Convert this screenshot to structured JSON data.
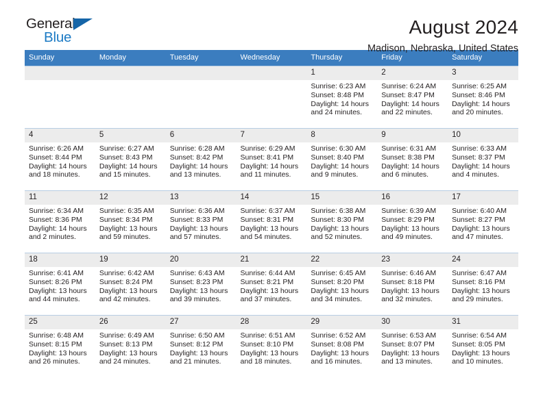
{
  "brand": {
    "name_part1": "General",
    "name_part2": "Blue",
    "accent_color": "#1b7ac4",
    "triangle_color": "#1565a8"
  },
  "header": {
    "title": "August 2024",
    "subtitle": "Madison, Nebraska, United States"
  },
  "calendar": {
    "header_bg": "#3b7dbf",
    "daynum_bg": "#ececec",
    "grid_line_color": "#b7cde3",
    "weekdays": [
      "Sunday",
      "Monday",
      "Tuesday",
      "Wednesday",
      "Thursday",
      "Friday",
      "Saturday"
    ],
    "labels": {
      "sunrise": "Sunrise:",
      "sunset": "Sunset:",
      "daylight": "Daylight:"
    },
    "weeks": [
      [
        {
          "day": "",
          "empty": true
        },
        {
          "day": "",
          "empty": true
        },
        {
          "day": "",
          "empty": true
        },
        {
          "day": "",
          "empty": true
        },
        {
          "day": "1",
          "sunrise": "Sunrise: 6:23 AM",
          "sunset": "Sunset: 8:48 PM",
          "daylight_line1": "Daylight: 14 hours",
          "daylight_line2": "and 24 minutes."
        },
        {
          "day": "2",
          "sunrise": "Sunrise: 6:24 AM",
          "sunset": "Sunset: 8:47 PM",
          "daylight_line1": "Daylight: 14 hours",
          "daylight_line2": "and 22 minutes."
        },
        {
          "day": "3",
          "sunrise": "Sunrise: 6:25 AM",
          "sunset": "Sunset: 8:46 PM",
          "daylight_line1": "Daylight: 14 hours",
          "daylight_line2": "and 20 minutes."
        }
      ],
      [
        {
          "day": "4",
          "sunrise": "Sunrise: 6:26 AM",
          "sunset": "Sunset: 8:44 PM",
          "daylight_line1": "Daylight: 14 hours",
          "daylight_line2": "and 18 minutes."
        },
        {
          "day": "5",
          "sunrise": "Sunrise: 6:27 AM",
          "sunset": "Sunset: 8:43 PM",
          "daylight_line1": "Daylight: 14 hours",
          "daylight_line2": "and 15 minutes."
        },
        {
          "day": "6",
          "sunrise": "Sunrise: 6:28 AM",
          "sunset": "Sunset: 8:42 PM",
          "daylight_line1": "Daylight: 14 hours",
          "daylight_line2": "and 13 minutes."
        },
        {
          "day": "7",
          "sunrise": "Sunrise: 6:29 AM",
          "sunset": "Sunset: 8:41 PM",
          "daylight_line1": "Daylight: 14 hours",
          "daylight_line2": "and 11 minutes."
        },
        {
          "day": "8",
          "sunrise": "Sunrise: 6:30 AM",
          "sunset": "Sunset: 8:40 PM",
          "daylight_line1": "Daylight: 14 hours",
          "daylight_line2": "and 9 minutes."
        },
        {
          "day": "9",
          "sunrise": "Sunrise: 6:31 AM",
          "sunset": "Sunset: 8:38 PM",
          "daylight_line1": "Daylight: 14 hours",
          "daylight_line2": "and 6 minutes."
        },
        {
          "day": "10",
          "sunrise": "Sunrise: 6:33 AM",
          "sunset": "Sunset: 8:37 PM",
          "daylight_line1": "Daylight: 14 hours",
          "daylight_line2": "and 4 minutes."
        }
      ],
      [
        {
          "day": "11",
          "sunrise": "Sunrise: 6:34 AM",
          "sunset": "Sunset: 8:36 PM",
          "daylight_line1": "Daylight: 14 hours",
          "daylight_line2": "and 2 minutes."
        },
        {
          "day": "12",
          "sunrise": "Sunrise: 6:35 AM",
          "sunset": "Sunset: 8:34 PM",
          "daylight_line1": "Daylight: 13 hours",
          "daylight_line2": "and 59 minutes."
        },
        {
          "day": "13",
          "sunrise": "Sunrise: 6:36 AM",
          "sunset": "Sunset: 8:33 PM",
          "daylight_line1": "Daylight: 13 hours",
          "daylight_line2": "and 57 minutes."
        },
        {
          "day": "14",
          "sunrise": "Sunrise: 6:37 AM",
          "sunset": "Sunset: 8:31 PM",
          "daylight_line1": "Daylight: 13 hours",
          "daylight_line2": "and 54 minutes."
        },
        {
          "day": "15",
          "sunrise": "Sunrise: 6:38 AM",
          "sunset": "Sunset: 8:30 PM",
          "daylight_line1": "Daylight: 13 hours",
          "daylight_line2": "and 52 minutes."
        },
        {
          "day": "16",
          "sunrise": "Sunrise: 6:39 AM",
          "sunset": "Sunset: 8:29 PM",
          "daylight_line1": "Daylight: 13 hours",
          "daylight_line2": "and 49 minutes."
        },
        {
          "day": "17",
          "sunrise": "Sunrise: 6:40 AM",
          "sunset": "Sunset: 8:27 PM",
          "daylight_line1": "Daylight: 13 hours",
          "daylight_line2": "and 47 minutes."
        }
      ],
      [
        {
          "day": "18",
          "sunrise": "Sunrise: 6:41 AM",
          "sunset": "Sunset: 8:26 PM",
          "daylight_line1": "Daylight: 13 hours",
          "daylight_line2": "and 44 minutes."
        },
        {
          "day": "19",
          "sunrise": "Sunrise: 6:42 AM",
          "sunset": "Sunset: 8:24 PM",
          "daylight_line1": "Daylight: 13 hours",
          "daylight_line2": "and 42 minutes."
        },
        {
          "day": "20",
          "sunrise": "Sunrise: 6:43 AM",
          "sunset": "Sunset: 8:23 PM",
          "daylight_line1": "Daylight: 13 hours",
          "daylight_line2": "and 39 minutes."
        },
        {
          "day": "21",
          "sunrise": "Sunrise: 6:44 AM",
          "sunset": "Sunset: 8:21 PM",
          "daylight_line1": "Daylight: 13 hours",
          "daylight_line2": "and 37 minutes."
        },
        {
          "day": "22",
          "sunrise": "Sunrise: 6:45 AM",
          "sunset": "Sunset: 8:20 PM",
          "daylight_line1": "Daylight: 13 hours",
          "daylight_line2": "and 34 minutes."
        },
        {
          "day": "23",
          "sunrise": "Sunrise: 6:46 AM",
          "sunset": "Sunset: 8:18 PM",
          "daylight_line1": "Daylight: 13 hours",
          "daylight_line2": "and 32 minutes."
        },
        {
          "day": "24",
          "sunrise": "Sunrise: 6:47 AM",
          "sunset": "Sunset: 8:16 PM",
          "daylight_line1": "Daylight: 13 hours",
          "daylight_line2": "and 29 minutes."
        }
      ],
      [
        {
          "day": "25",
          "sunrise": "Sunrise: 6:48 AM",
          "sunset": "Sunset: 8:15 PM",
          "daylight_line1": "Daylight: 13 hours",
          "daylight_line2": "and 26 minutes."
        },
        {
          "day": "26",
          "sunrise": "Sunrise: 6:49 AM",
          "sunset": "Sunset: 8:13 PM",
          "daylight_line1": "Daylight: 13 hours",
          "daylight_line2": "and 24 minutes."
        },
        {
          "day": "27",
          "sunrise": "Sunrise: 6:50 AM",
          "sunset": "Sunset: 8:12 PM",
          "daylight_line1": "Daylight: 13 hours",
          "daylight_line2": "and 21 minutes."
        },
        {
          "day": "28",
          "sunrise": "Sunrise: 6:51 AM",
          "sunset": "Sunset: 8:10 PM",
          "daylight_line1": "Daylight: 13 hours",
          "daylight_line2": "and 18 minutes."
        },
        {
          "day": "29",
          "sunrise": "Sunrise: 6:52 AM",
          "sunset": "Sunset: 8:08 PM",
          "daylight_line1": "Daylight: 13 hours",
          "daylight_line2": "and 16 minutes."
        },
        {
          "day": "30",
          "sunrise": "Sunrise: 6:53 AM",
          "sunset": "Sunset: 8:07 PM",
          "daylight_line1": "Daylight: 13 hours",
          "daylight_line2": "and 13 minutes."
        },
        {
          "day": "31",
          "sunrise": "Sunrise: 6:54 AM",
          "sunset": "Sunset: 8:05 PM",
          "daylight_line1": "Daylight: 13 hours",
          "daylight_line2": "and 10 minutes."
        }
      ]
    ]
  }
}
